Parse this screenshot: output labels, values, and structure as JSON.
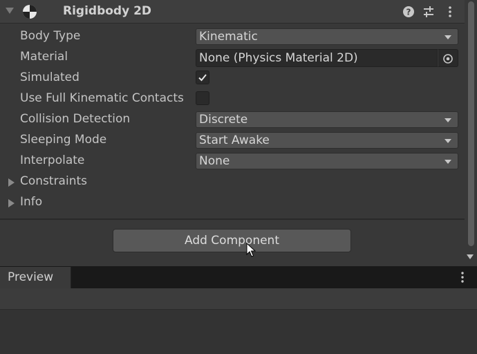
{
  "component": {
    "title": "Rigidbody 2D"
  },
  "properties": {
    "body_type": {
      "label": "Body Type",
      "value": "Kinematic"
    },
    "material": {
      "label": "Material",
      "value": "None (Physics Material 2D)"
    },
    "simulated": {
      "label": "Simulated",
      "checked": true
    },
    "use_full_kinematic_contacts": {
      "label": "Use Full Kinematic Contacts",
      "checked": false
    },
    "collision_detection": {
      "label": "Collision Detection",
      "value": "Discrete"
    },
    "sleeping_mode": {
      "label": "Sleeping Mode",
      "value": "Start Awake"
    },
    "interpolate": {
      "label": "Interpolate",
      "value": "None"
    }
  },
  "foldouts": {
    "constraints": "Constraints",
    "info": "Info"
  },
  "add_component_label": "Add Component",
  "preview": {
    "tab_label": "Preview"
  },
  "icons": {
    "header": [
      "foldout-arrow-icon",
      "rigidbody-component-icon",
      "help-icon",
      "presets-icon",
      "more-options-icon"
    ],
    "fields": [
      "dropdown-arrow-icon",
      "object-picker-icon",
      "checkmark-icon",
      "foldout-arrow-icon"
    ],
    "other": [
      "mouse-cursor-icon",
      "scroll-down-arrow-icon",
      "more-options-icon"
    ]
  },
  "colors": {
    "background": "#383838",
    "header": "#3e3e3e",
    "field": "#515151",
    "object_field": "#2a2a2a",
    "text": "#c4c4c4"
  }
}
